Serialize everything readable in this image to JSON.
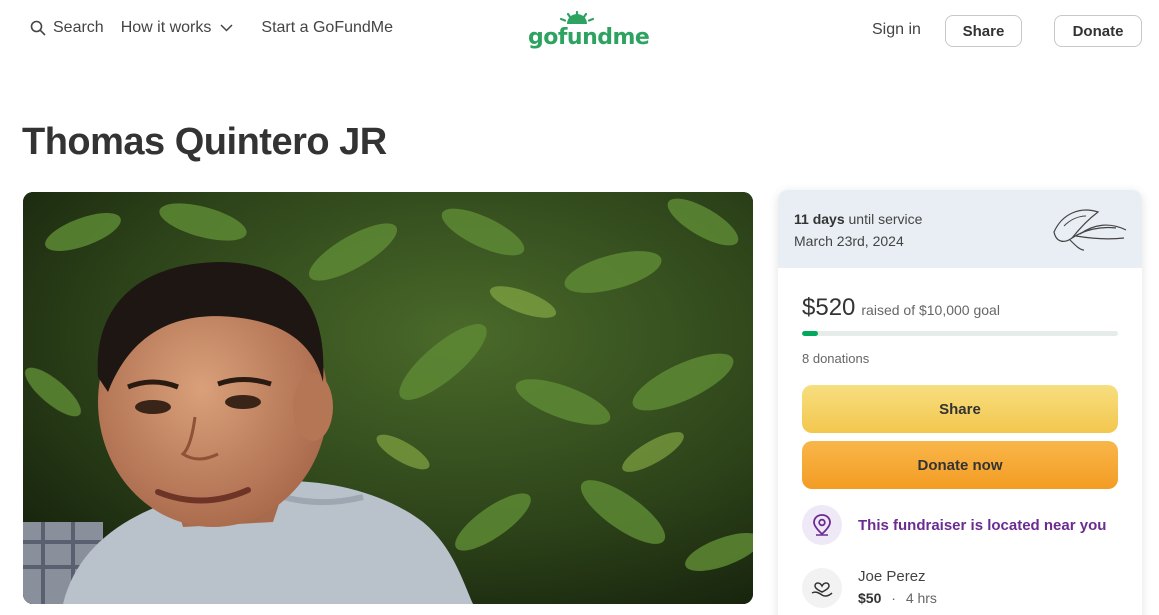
{
  "header": {
    "search_label": "Search",
    "how_it_works_label": "How it works",
    "start_label": "Start a GoFundMe",
    "logo_text": "gofundme",
    "sign_in_label": "Sign in",
    "share_label": "Share",
    "donate_label": "Donate"
  },
  "page": {
    "title": "Thomas Quintero JR"
  },
  "card": {
    "service_days": "11 days",
    "service_suffix": "until service",
    "service_date": "March 23rd, 2024",
    "raised_amount": "$520",
    "raised_goal_text": "raised of $10,000 goal",
    "raised_value": 520,
    "goal_value": 10000,
    "donations_count": "8 donations",
    "share_button": "Share",
    "donate_button": "Donate now",
    "nearby_text": "This fundraiser is located near you",
    "recent_donor": {
      "name": "Joe Perez",
      "amount": "$50",
      "separator": "·",
      "time": "4 hrs"
    }
  },
  "colors": {
    "brand_green": "#02a95c",
    "share_yellow": "#f3c74d",
    "donate_orange": "#f39c23",
    "nearby_purple": "#6b2c91"
  },
  "icons": {
    "search": "search-icon",
    "chevron": "chevron-down-icon",
    "lily": "lily-flower-icon",
    "location": "location-pin-icon",
    "donor": "heart-hand-icon"
  }
}
